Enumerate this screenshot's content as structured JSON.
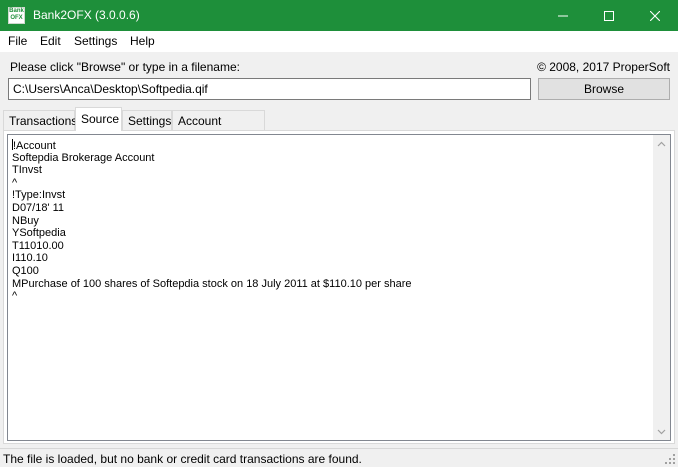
{
  "window": {
    "title": "Bank2OFX (3.0.0.6)",
    "icon_text_top": "Bank",
    "icon_text_bottom": "OFX",
    "accent_color": "#1e8f3a"
  },
  "menu": {
    "file": "File",
    "edit": "Edit",
    "settings": "Settings",
    "help": "Help"
  },
  "header": {
    "prompt": "Please click \"Browse\" or type in a filename:",
    "copyright": "© 2008, 2017 ProperSoft"
  },
  "file_input": {
    "value": "C:\\Users\\Anca\\Desktop\\Softpedia.qif"
  },
  "browse_button": {
    "label": "Browse"
  },
  "tabs": [
    {
      "label": "Transactions",
      "active": false
    },
    {
      "label": "Source",
      "active": true
    },
    {
      "label": "Settings",
      "active": false
    },
    {
      "label": "Account Mapping",
      "active": false
    }
  ],
  "source": {
    "lines": [
      "!Account",
      "Softepdia Brokerage Account",
      "TInvst",
      "^",
      "!Type:Invst",
      "D07/18' 11",
      "NBuy",
      "YSoftpedia",
      "T11010.00",
      "I110.10",
      "Q100",
      "MPurchase of 100 shares of Softepdia stock on 18 July 2011 at $110.10 per share",
      "^"
    ]
  },
  "status": {
    "text": "The file is loaded, but no bank or credit card transactions are found."
  },
  "icons": {
    "minimize": "minimize-icon",
    "maximize": "maximize-icon",
    "close": "close-icon",
    "scroll_up": "chevron-up-icon",
    "scroll_down": "chevron-down-icon",
    "resize_grip": "resize-grip-icon"
  }
}
